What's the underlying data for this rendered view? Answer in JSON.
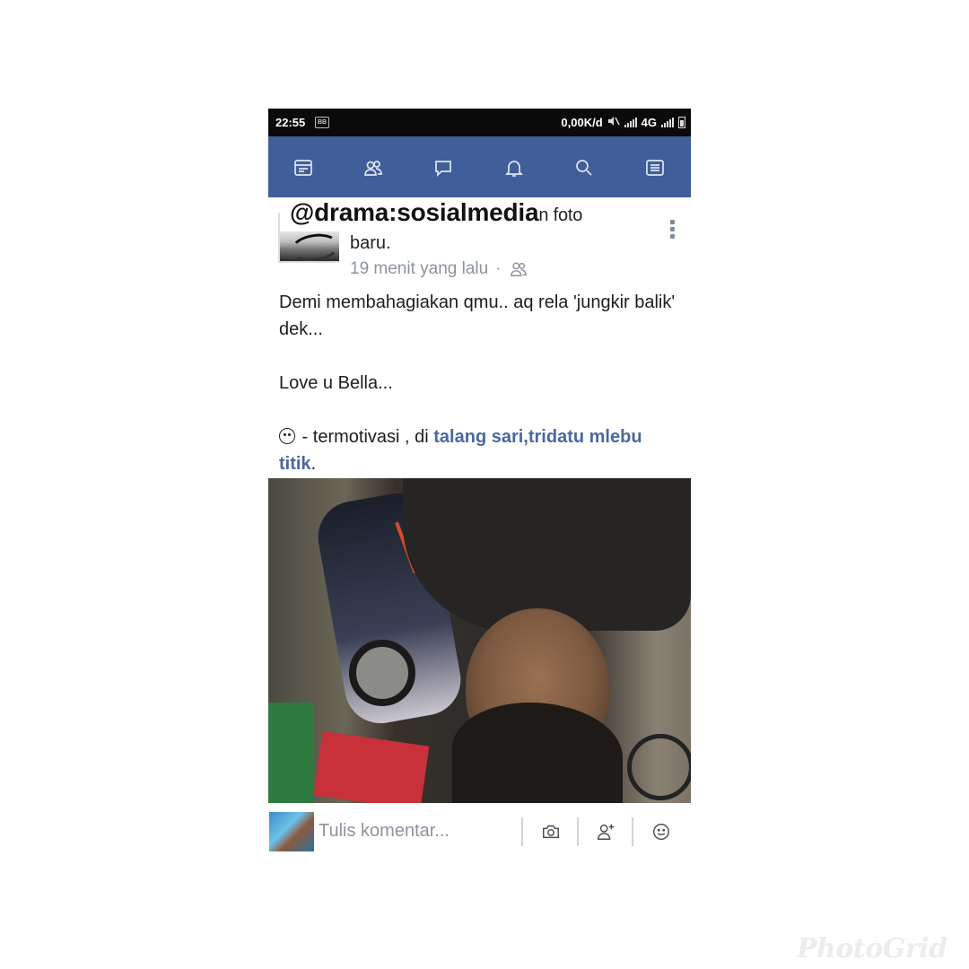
{
  "status_bar": {
    "time": "22:55",
    "data_rate": "0,00K/d",
    "network": "4G",
    "icons": [
      "blackberry-messenger-icon",
      "mute-icon",
      "signal-icon",
      "battery-icon"
    ]
  },
  "nav_bar": {
    "color": "#3f5e9a",
    "icons": [
      "news-feed-icon",
      "friends-icon",
      "messages-icon",
      "notifications-icon",
      "search-icon",
      "menu-icon"
    ]
  },
  "post": {
    "author": "@drama:sosialmedia",
    "action_line1": "n foto",
    "action_line2": "baru.",
    "time": "19 menit yang lalu",
    "separator": "·",
    "audience_icon": "friends-icon",
    "body": {
      "line1": "Demi membahagiakan qmu.. aq rela 'jungkir balik' dek...",
      "line2": "Love u Bella...",
      "feeling_text": " - termotivasi , di ",
      "location": "talang sari,tridatu mlebu titik",
      "end": "."
    },
    "link_color": "#4b67a1"
  },
  "comment_bar": {
    "placeholder": "Tulis komentar...",
    "icons": [
      "camera-icon",
      "tag-friend-icon",
      "emoji-icon"
    ]
  },
  "watermark": "PhotoGrid"
}
